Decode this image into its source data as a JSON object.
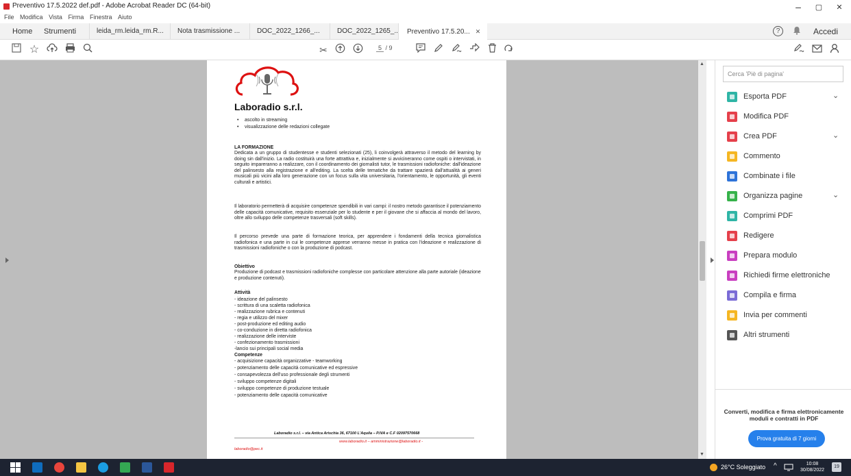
{
  "window": {
    "title": "Preventivo 17.5.2022 def.pdf - Adobe Acrobat Reader DC (64-bit)",
    "minimize": "–",
    "maximize": "▢",
    "close": "✕"
  },
  "menu": [
    "File",
    "Modifica",
    "Vista",
    "Firma",
    "Finestra",
    "Aiuto"
  ],
  "tabs": {
    "home": "Home",
    "strumenti": "Strumenti",
    "docs": [
      {
        "label": "leida_rm.leida_rm.R..."
      },
      {
        "label": "Nota trasmissione ..."
      },
      {
        "label": "DOC_2022_1266_..."
      },
      {
        "label": "DOC_2022_1265_..."
      },
      {
        "label": "Preventivo 17.5.20..."
      }
    ],
    "close_glyph": "✕",
    "help": "?",
    "accedi": "Accedi"
  },
  "toolbar": {
    "page_current": "5",
    "page_total": "/ 9"
  },
  "document": {
    "brand": "Laboradio s.r.l.",
    "bullets": [
      "ascolto in streaming",
      "visualizzazione delle redazioni collegate"
    ],
    "formazione_title": "LA FORMAZIONE",
    "formazione_p1": "Dedicata a un gruppo di studentesse e studenti selezionati (25), li coinvolgerà attraverso il metodo del learning by doing sin dall'inizio. La radio costituirà una forte attrattiva e, inizialmente si avvicineranno come ospiti o intervistati, in seguito impareranno a realizzare, con il coordinamento dei giornalisti tutor, le trasmissioni radiofoniche: dall'ideazione del palinsesto alla registrazione e all'editing. La scelta delle tematiche da trattare spazierà dall'attualità ai generi musicali più vicini alla loro generazione con un focus sulla vita universitaria, l'orientamento, le opportunità, gli eventi culturali e artistici.",
    "formazione_p2": "Il laboratorio permetterà di acquisire competenze spendibili in vari campi: il nostro metodo garantisce il potenziamento delle capacità comunicative, requisito essenziale per lo studente e per il giovane che si affaccia al mondo del lavoro, oltre allo sviluppo delle competenze trasversali (soft skills).",
    "formazione_p3": "Il percorso prevede una parte di formazione teorica, per apprendere i fondamenti della tecnica giornalistica radiofonica e una parte in cui le competenze apprese verranno messe in pratica con l'ideazione e realizzazione di trasmissioni radiofoniche o con la produzione di podcast.",
    "obiettivo_title": "Obiettivo",
    "obiettivo_text": "Produzione di podcast e trasmissioni radiofoniche complesse con particolare attenzione alla parte autoriale (ideazione e produzione contenuti).",
    "attivita_title": "Attività",
    "attivita": [
      "- ideazione del palinsesto",
      "- scrittura di una scaletta radiofonica",
      "- realizzazione rubrica e contenuti",
      "- regia e utilizzo del mixer",
      "- post-produzione ed editing audio",
      "- co-conduzione in diretta radiofonica",
      "- realizzazione delle interviste",
      "- confezionamento trasmissioni",
      "-lancio sui principali social media"
    ],
    "competenze_title": "Competenze",
    "competenze": [
      "- acquisizione capacità organizzative - teamworking",
      "- potenziamento delle capacità comunicative ed espressive",
      "- consapevolezza dell'uso professionale degli strumenti",
      "- sviluppo competenze digitali",
      "- sviluppo competenze di produzione testuale",
      "- potenziamento delle capacità comunicative"
    ],
    "footer_address": "Laboradio s.r.l. – via Antica Arischia 36, 67100 L'Aquila – P.IVA e C.F 02097570668",
    "footer_web": "www.laboradio.it – amministrazione@laboradio.it -",
    "footer_pec": "laboradio@pec.it"
  },
  "right_panel": {
    "search_placeholder": "Cerca 'Piè di pagina'",
    "items": [
      {
        "label": "Esporta PDF",
        "color": "#2fb5a6",
        "chevron": true
      },
      {
        "label": "Modifica PDF",
        "color": "#e5404b",
        "chevron": false
      },
      {
        "label": "Crea PDF",
        "color": "#e5404b",
        "chevron": true
      },
      {
        "label": "Commento",
        "color": "#f5b622",
        "chevron": false
      },
      {
        "label": "Combinate i file",
        "color": "#2e73d9",
        "chevron": false
      },
      {
        "label": "Organizza pagine",
        "color": "#36b24a",
        "chevron": true
      },
      {
        "label": "Comprimi PDF",
        "color": "#2fb5a6",
        "chevron": false
      },
      {
        "label": "Redigere",
        "color": "#e5404b",
        "chevron": false
      },
      {
        "label": "Prepara modulo",
        "color": "#c93fc0",
        "chevron": false
      },
      {
        "label": "Richiedi firme elettroniche",
        "color": "#c93fc0",
        "chevron": false
      },
      {
        "label": "Compila e firma",
        "color": "#7a6bd6",
        "chevron": false
      },
      {
        "label": "Invia per commenti",
        "color": "#f5b622",
        "chevron": false
      },
      {
        "label": "Altri strumenti",
        "color": "#555555",
        "chevron": false
      }
    ],
    "chevron_glyph": "⌄",
    "promo": "Converti, modifica e firma elettronicamente moduli e contratti in PDF",
    "trial_button": "Prova gratuita di 7 giorni"
  },
  "taskbar": {
    "weather": "26°C Soleggiato",
    "time": "10:08",
    "date": "30/08/2022",
    "notifications": "19"
  }
}
